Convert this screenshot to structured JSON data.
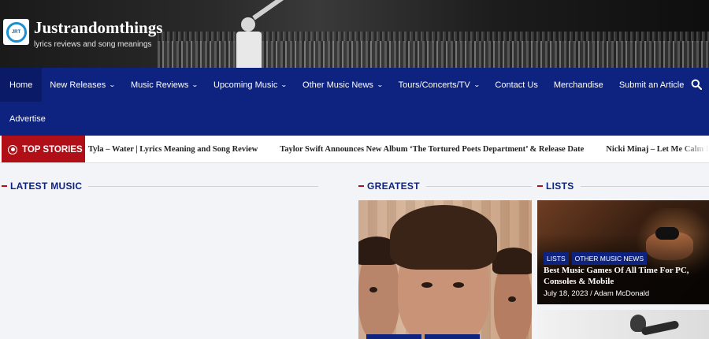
{
  "header": {
    "logo_text": "JRT",
    "site_title": "Justrandomthings",
    "tagline": "lyrics reviews and song meanings"
  },
  "nav": {
    "items": [
      {
        "label": "Home",
        "dropdown": false,
        "active": true
      },
      {
        "label": "New Releases",
        "dropdown": true
      },
      {
        "label": "Music Reviews",
        "dropdown": true
      },
      {
        "label": "Upcoming Music",
        "dropdown": true
      },
      {
        "label": "Other Music News",
        "dropdown": true
      },
      {
        "label": "Tours/Concerts/TV",
        "dropdown": true
      },
      {
        "label": "Contact Us",
        "dropdown": false
      },
      {
        "label": "Merchandise",
        "dropdown": false
      },
      {
        "label": "Submit an Article",
        "dropdown": false
      },
      {
        "label": "Advertise",
        "dropdown": false
      }
    ],
    "search_icon": "search-icon"
  },
  "ticker": {
    "label": "TOP STORIES",
    "items": [
      "Tyla – Water | Lyrics Meaning and Song Review",
      "Taylor Swift Announces New Album ‘The Tortured Poets Department’ & Release Date",
      "Nicki Minaj – Let Me Calm Down Ft. J."
    ]
  },
  "sections": {
    "latest": "LATEST MUSIC",
    "greatest": "GREATEST",
    "lists": "LISTS"
  },
  "lists_card": {
    "tags": [
      "LISTS",
      "OTHER MUSIC NEWS"
    ],
    "title": "Best Music Games Of All Time For PC, Consoles & Mobile",
    "date": "July 18, 2023",
    "separator": "/",
    "author": "Adam McDonald"
  },
  "colors": {
    "nav_bg": "#0d237f",
    "accent_red": "#b10f17",
    "page_bg": "#f3f4f7"
  }
}
